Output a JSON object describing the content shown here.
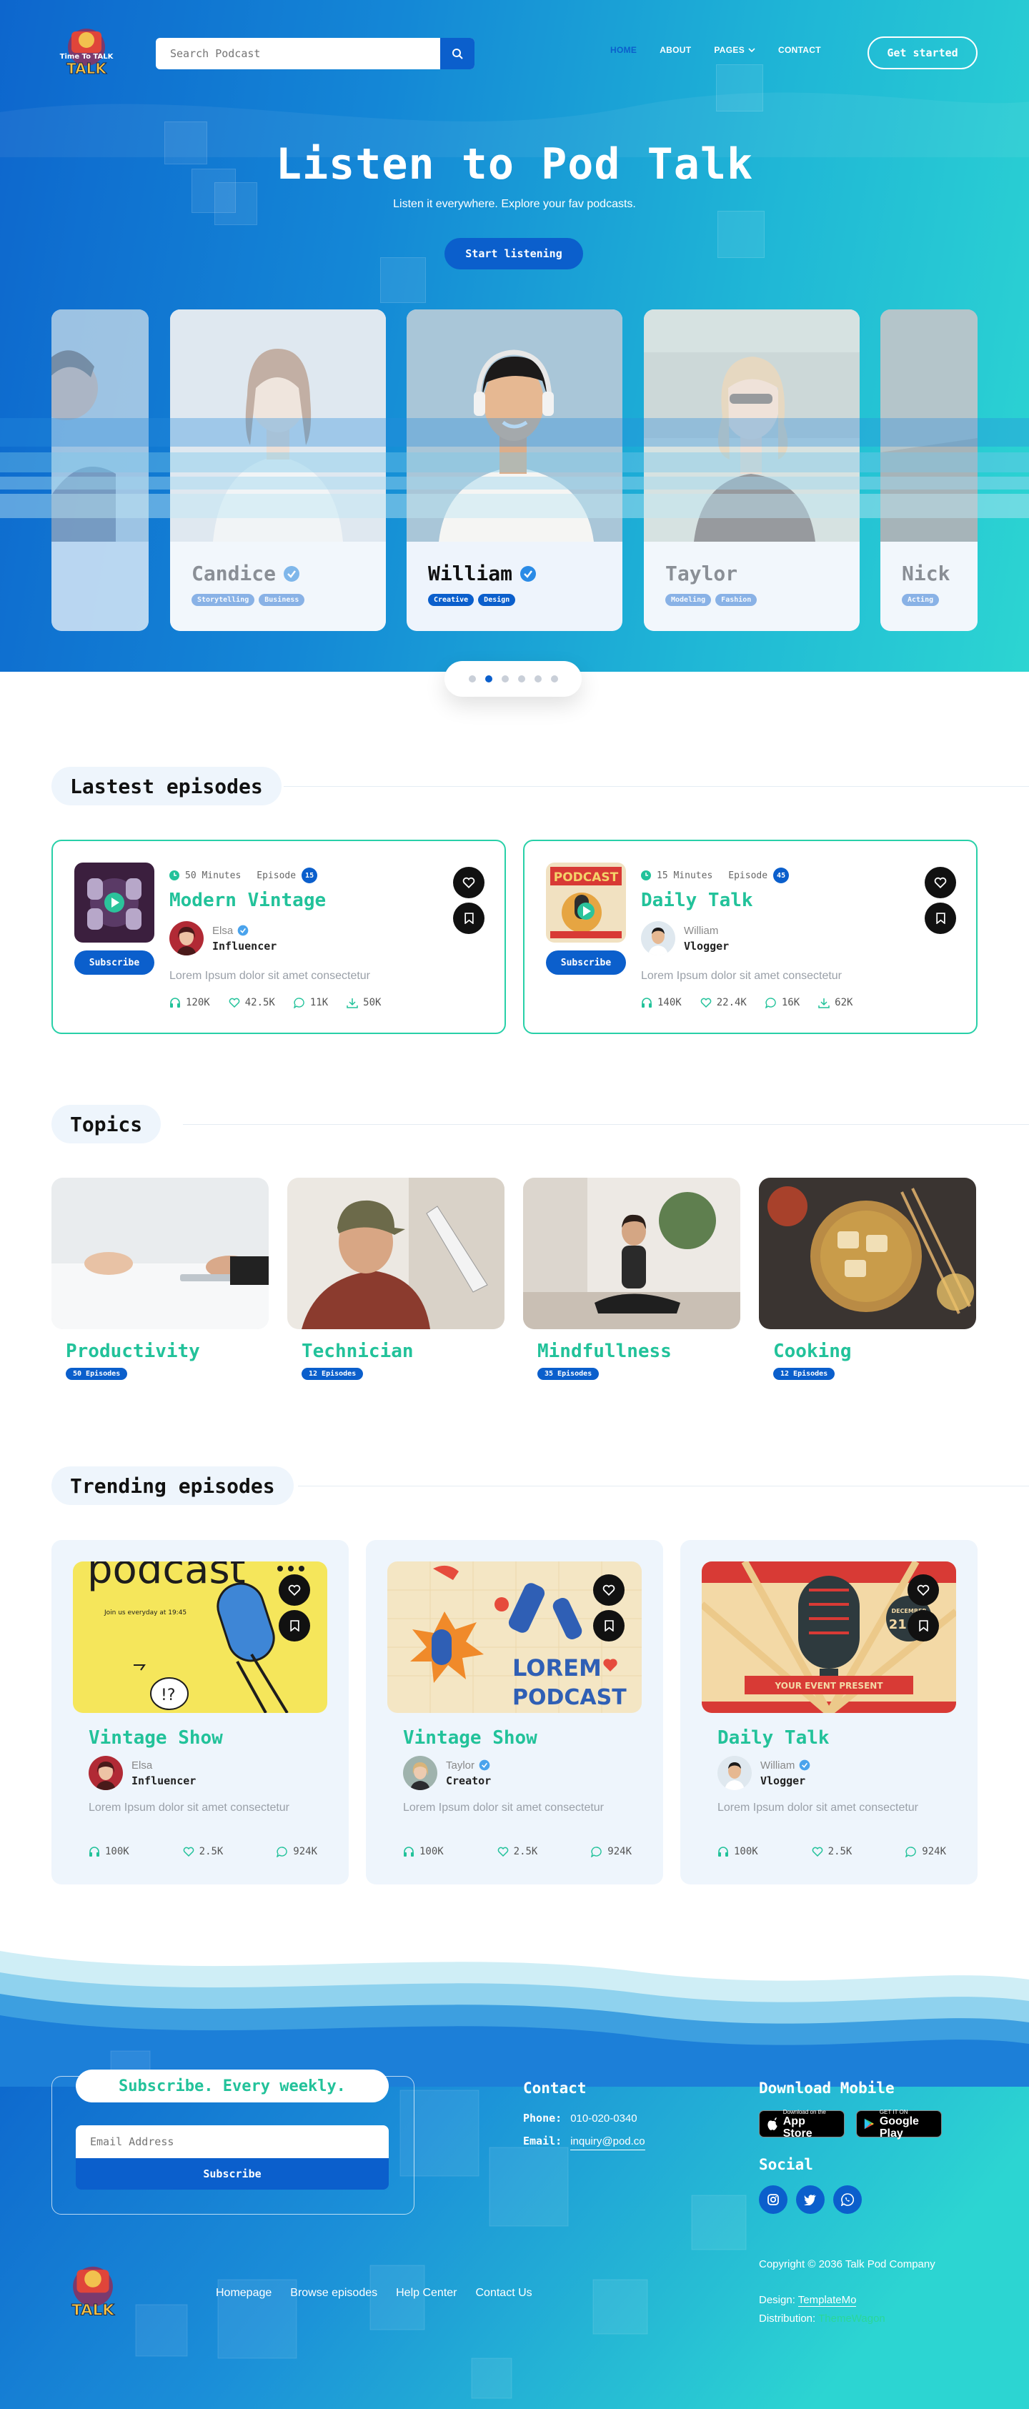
{
  "header": {
    "logo_text": "Time To TALK",
    "search_placeholder": "Search Podcast",
    "nav": [
      "HOME",
      "ABOUT",
      "PAGES",
      "CONTACT"
    ],
    "cta": "Get started"
  },
  "hero": {
    "title": "Listen to Pod Talk",
    "subtitle": "Listen it everywhere. Explore your fav podcasts.",
    "button": "Start listening"
  },
  "profiles": [
    {
      "name": "Candice",
      "tags": [
        "Storytelling",
        "Business"
      ]
    },
    {
      "name": "William",
      "tags": [
        "Creative",
        "Design"
      ]
    },
    {
      "name": "Taylor",
      "tags": [
        "Modeling",
        "Fashion"
      ]
    },
    {
      "name": "Nick",
      "tags": [
        "Acting"
      ]
    }
  ],
  "carousel": {
    "dots": 6,
    "active": 1
  },
  "latest": {
    "heading": "Lastest episodes",
    "items": [
      {
        "duration": "50 Minutes",
        "episode_label": "Episode",
        "episode_no": "15",
        "title": "Modern Vintage",
        "host": "Elsa",
        "role": "Influencer",
        "desc": "Lorem Ipsum dolor sit amet consectetur",
        "listens": "120K",
        "likes": "42.5K",
        "comments": "11K",
        "downloads": "50K",
        "subscribe": "Subscribe"
      },
      {
        "duration": "15 Minutes",
        "episode_label": "Episode",
        "episode_no": "45",
        "title": "Daily Talk",
        "host": "William",
        "role": "Vlogger",
        "desc": "Lorem Ipsum dolor sit amet consectetur",
        "listens": "140K",
        "likes": "22.4K",
        "comments": "16K",
        "downloads": "62K",
        "subscribe": "Subscribe"
      }
    ]
  },
  "topics": {
    "heading": "Topics",
    "items": [
      {
        "name": "Productivity",
        "count": "50 Episodes"
      },
      {
        "name": "Technician",
        "count": "12 Episodes"
      },
      {
        "name": "Mindfullness",
        "count": "35 Episodes"
      },
      {
        "name": "Cooking",
        "count": "12 Episodes"
      }
    ]
  },
  "trending": {
    "heading": "Trending episodes",
    "items": [
      {
        "title": "Vintage Show",
        "host": "Elsa",
        "role": "Influencer",
        "desc": "Lorem Ipsum dolor sit amet consectetur",
        "listens": "100K",
        "likes": "2.5K",
        "comments": "924K",
        "art_top": "podcast",
        "art_sub": "Join us everyday at 19:45",
        "art_mark": "!?"
      },
      {
        "title": "Vintage Show",
        "host": "Taylor",
        "role": "Creator",
        "desc": "Lorem Ipsum dolor sit amet consectetur",
        "listens": "100K",
        "likes": "2.5K",
        "comments": "924K",
        "art_top": "LOREM",
        "art_sub": "PODCAST"
      },
      {
        "title": "Daily Talk",
        "host": "William",
        "role": "Vlogger",
        "desc": "Lorem Ipsum dolor sit amet consectetur",
        "listens": "100K",
        "likes": "2.5K",
        "comments": "924K",
        "art_top": "YOUR EVENT PRESENT",
        "art_sub": "DECEMBER",
        "art_day": "21 ST"
      }
    ]
  },
  "footer": {
    "subscribe_title": "Subscribe. Every weekly.",
    "email_placeholder": "Email Address",
    "subscribe_button": "Subscribe",
    "contact_heading": "Contact",
    "phone_label": "Phone:",
    "phone": "010-020-0340",
    "email_label": "Email:",
    "email": "inquiry@pod.co",
    "download_heading": "Download Mobile",
    "appstore_small": "Download on the",
    "appstore": "App Store",
    "gplay_small": "GET IT ON",
    "gplay": "Google Play",
    "social_heading": "Social",
    "links": [
      "Homepage",
      "Browse episodes",
      "Help Center",
      "Contact Us"
    ],
    "copyright": "Copyright © 2036 Talk Pod Company",
    "design_label": "Design:",
    "design_by": "TemplateMo",
    "distribution_label": "Distribution:",
    "distribution_by": "ThemeWagon"
  },
  "colors": {
    "primary": "#0b5fcc",
    "accent": "#22c29a",
    "hero_start": "#0d66cd",
    "hero_end": "#2cd5d2"
  }
}
